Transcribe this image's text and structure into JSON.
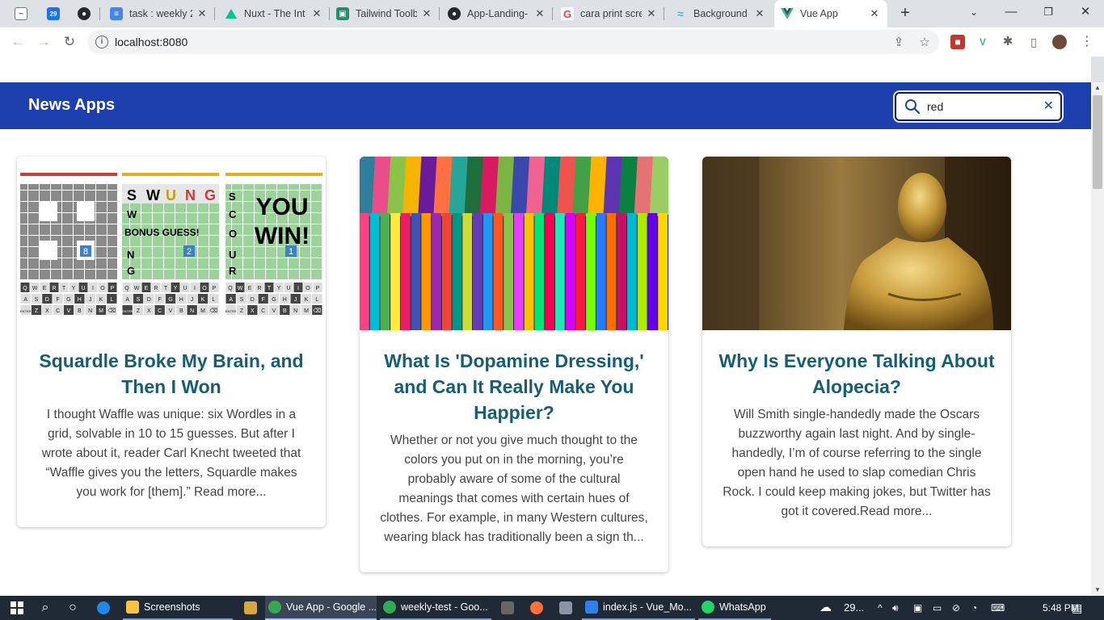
{
  "browser": {
    "tabs": [
      {
        "title": "",
        "favicon": "pinned-icon",
        "color": "#5f6368"
      },
      {
        "title": "",
        "favicon": "calendar-icon",
        "color": "#1a73e8"
      },
      {
        "title": "",
        "favicon": "github-icon",
        "color": "#24292e"
      },
      {
        "title": "task : weekly 2",
        "favicon": "docs-icon",
        "color": "#4285f4"
      },
      {
        "title": "Nuxt - The Int",
        "favicon": "nuxt-icon",
        "color": "#00c58e"
      },
      {
        "title": "Tailwind Toolb",
        "favicon": "toolbox-icon",
        "color": "#2b8a6b"
      },
      {
        "title": "App-Landing-",
        "favicon": "github-icon",
        "color": "#24292e"
      },
      {
        "title": "cara print scre",
        "favicon": "google-icon",
        "color": "#ea4335"
      },
      {
        "title": "Background Ir",
        "favicon": "tailwind-icon",
        "color": "#38bdf8"
      },
      {
        "title": "Vue App",
        "favicon": "vue-icon",
        "color": "#41b883",
        "active": true
      }
    ],
    "url": "localhost:8080"
  },
  "app": {
    "brand": "News Apps",
    "search": {
      "value": "red",
      "placeholder": ""
    }
  },
  "articles": [
    {
      "title": "Squardle Broke My Brain, and Then I Won",
      "excerpt": "I thought Waffle was unique: six Wordles in a grid, solvable in 10 to 15 guesses. But after I wrote about it, reader Carl Knecht tweeted that “Waffle gives you the letters, Squardle makes you work for [them].” Read more...",
      "image": "squardle-game-screenshots",
      "image_text": {
        "board2_tiles": [
          "S",
          "W",
          "U",
          "N",
          "G",
          "W",
          "N",
          "G"
        ],
        "board2_banner": "BONUS GUESS!",
        "board2_number": "2",
        "board3_banner_top": "YOU",
        "board3_banner_bottom": "WIN!",
        "board3_tiles": [
          "S",
          "C",
          "O",
          "U",
          "R"
        ],
        "board3_number": "1",
        "board1_number": "8",
        "keyboard_row1": [
          "Q",
          "W",
          "E",
          "R",
          "T",
          "Y",
          "U",
          "I",
          "O",
          "P"
        ],
        "keyboard_row2": [
          "A",
          "S",
          "D",
          "F",
          "G",
          "H",
          "J",
          "K",
          "L"
        ],
        "keyboard_row3": [
          "ENTER",
          "Z",
          "X",
          "C",
          "V",
          "B",
          "N",
          "M",
          "⌫"
        ]
      }
    },
    {
      "title": "What Is 'Dopamine Dressing,' and Can It Really Make You Happier?",
      "excerpt": "Whether or not you give much thought to the colors you put on in the morning, you’re probably aware of some of the cultural meanings that comes with certain hues of clothes. For example, in many Western cultures, wearing black has traditionally been a sign th...",
      "image": "colorful-clothes-rack"
    },
    {
      "title": "Why Is Everyone Talking About Alopecia?",
      "excerpt": "Will Smith single-handedly made the Oscars buzzworthy again last night. And by single-handedly, I’m of course referring to the single open hand he used to slap comedian Chris Rock. I could keep making jokes, but Twitter has got it covered.Read more...",
      "image": "oscar-statue"
    }
  ],
  "taskbar": {
    "items": [
      {
        "label": "Screenshots",
        "icon": "folder-icon",
        "color": "#f6c342"
      },
      {
        "label": "Vue App - Google ...",
        "icon": "chrome-icon",
        "color": "#34a853",
        "active": true
      },
      {
        "label": "weekly-test - Goo...",
        "icon": "chrome-icon",
        "color": "#34a853"
      },
      {
        "label": "index.js - Vue_Mo...",
        "icon": "vscode-icon",
        "color": "#2f80ed"
      },
      {
        "label": "WhatsApp",
        "icon": "whatsapp-icon",
        "color": "#25d366"
      }
    ],
    "weather": "29...",
    "time": "5:48 PM"
  },
  "colors": {
    "appbar": "#1e40af",
    "title": "#155e75",
    "search_border": "#0b1c5a"
  }
}
